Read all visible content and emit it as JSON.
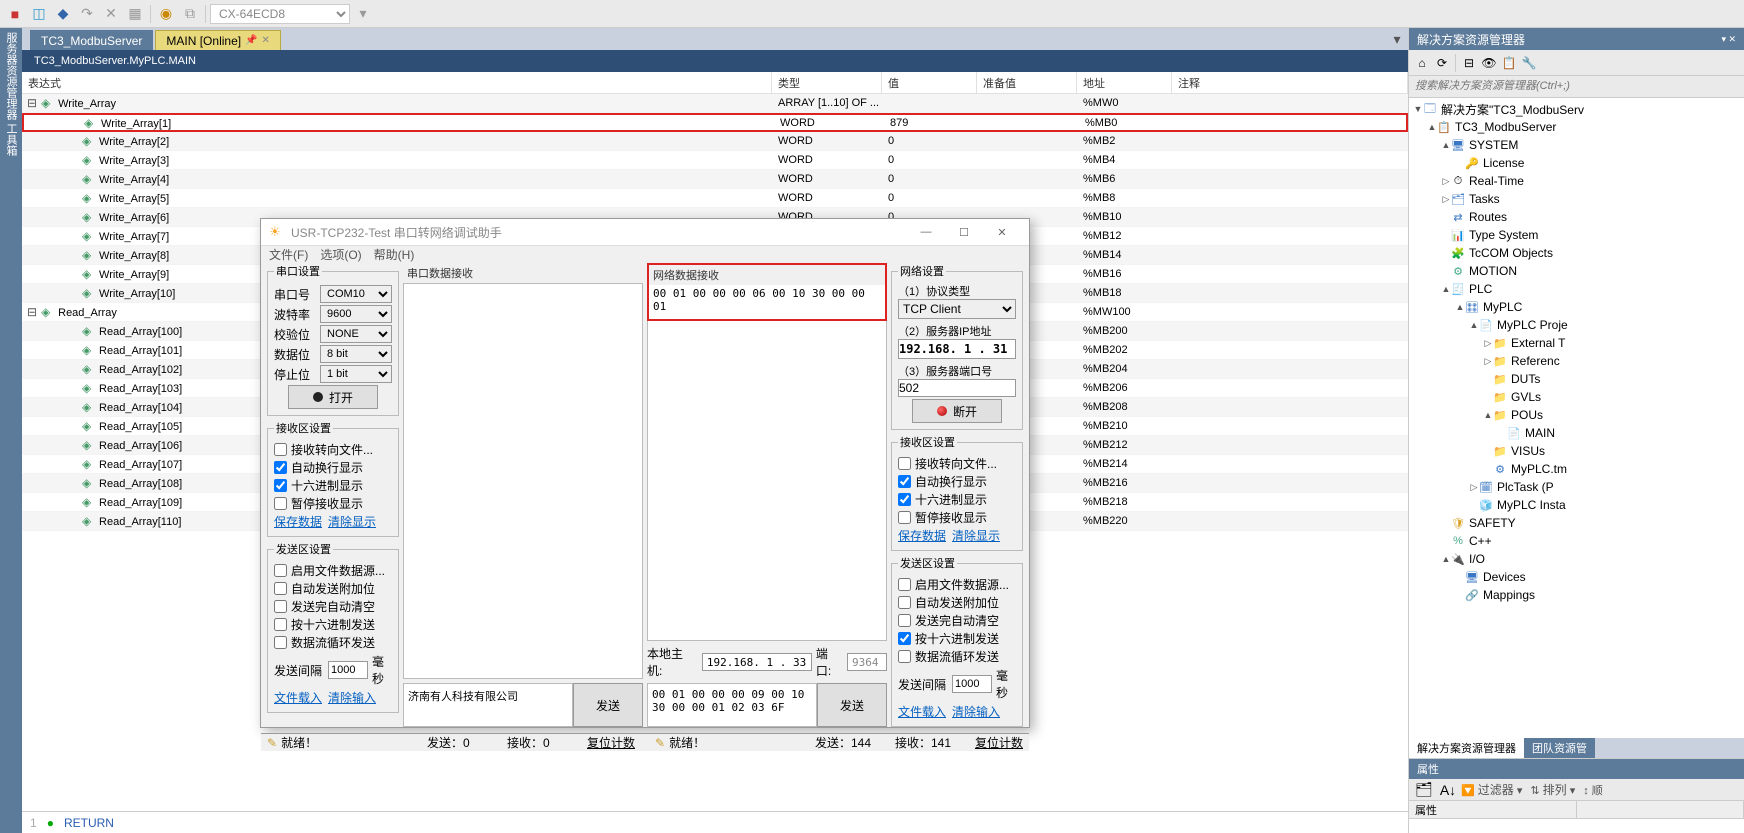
{
  "toolbar_combo": "CX-64ECD8",
  "left_sidebar_label": "服务器资源管理器 工具箱",
  "tabs": [
    {
      "label": "TC3_ModbuServer",
      "active": false
    },
    {
      "label": "MAIN [Online]",
      "active": true
    }
  ],
  "breadcrumb": "TC3_ModbuServer.MyPLC.MAIN",
  "columns": {
    "expr": "表达式",
    "type": "类型",
    "val": "值",
    "prep": "准备值",
    "addr": "地址",
    "comment": "注释"
  },
  "write_array_root": {
    "name": "Write_Array",
    "type": "ARRAY [1..10] OF ...",
    "addr": "%MW0"
  },
  "write_items": [
    {
      "name": "Write_Array[1]",
      "type": "WORD",
      "val": "879",
      "addr": "%MB0",
      "hl": true
    },
    {
      "name": "Write_Array[2]",
      "type": "WORD",
      "val": "0",
      "addr": "%MB2"
    },
    {
      "name": "Write_Array[3]",
      "type": "WORD",
      "val": "0",
      "addr": "%MB4"
    },
    {
      "name": "Write_Array[4]",
      "type": "WORD",
      "val": "0",
      "addr": "%MB6"
    },
    {
      "name": "Write_Array[5]",
      "type": "WORD",
      "val": "0",
      "addr": "%MB8"
    },
    {
      "name": "Write_Array[6]",
      "type": "WORD",
      "val": "0",
      "addr": "%MB10"
    },
    {
      "name": "Write_Array[7]",
      "type": "WORD",
      "val": "0",
      "addr": "%MB12"
    },
    {
      "name": "Write_Array[8]",
      "type": "WORD",
      "val": "0",
      "addr": "%MB14"
    },
    {
      "name": "Write_Array[9]",
      "type": "WORD",
      "val": "0",
      "addr": "%MB16"
    },
    {
      "name": "Write_Array[10]",
      "type": "WORD",
      "val": "0",
      "addr": "%MB18"
    }
  ],
  "read_array_root": {
    "name": "Read_Array",
    "addr": "%MW100"
  },
  "read_items": [
    {
      "name": "Read_Array[100]",
      "addr": "%MB200"
    },
    {
      "name": "Read_Array[101]",
      "addr": "%MB202"
    },
    {
      "name": "Read_Array[102]",
      "addr": "%MB204"
    },
    {
      "name": "Read_Array[103]",
      "addr": "%MB206"
    },
    {
      "name": "Read_Array[104]",
      "addr": "%MB208"
    },
    {
      "name": "Read_Array[105]",
      "addr": "%MB210"
    },
    {
      "name": "Read_Array[106]",
      "addr": "%MB212"
    },
    {
      "name": "Read_Array[107]",
      "addr": "%MB214"
    },
    {
      "name": "Read_Array[108]",
      "addr": "%MB216"
    },
    {
      "name": "Read_Array[109]",
      "addr": "%MB218"
    },
    {
      "name": "Read_Array[110]",
      "addr": "%MB220"
    }
  ],
  "code_line_num": "1",
  "code_line": "RETURN",
  "solution_explorer": {
    "title": "解决方案资源管理器",
    "search_placeholder": "搜索解决方案资源管理器(Ctrl+;)",
    "nodes": [
      {
        "d": 0,
        "exp": "▼",
        "icon": "🗔",
        "iconClass": "blue-icon",
        "label": "解决方案\"TC3_ModbuServ"
      },
      {
        "d": 1,
        "exp": "▲",
        "icon": "📋",
        "iconClass": "blue-icon",
        "label": "TC3_ModbuServer"
      },
      {
        "d": 2,
        "exp": "▲",
        "icon": "🖥",
        "iconClass": "blue-icon",
        "label": "SYSTEM"
      },
      {
        "d": 3,
        "exp": "",
        "icon": "🔑",
        "iconClass": "",
        "label": "License"
      },
      {
        "d": 2,
        "exp": "▷",
        "icon": "⏱",
        "iconClass": "",
        "label": "Real-Time"
      },
      {
        "d": 2,
        "exp": "▷",
        "icon": "🗂",
        "iconClass": "blue-icon",
        "label": "Tasks"
      },
      {
        "d": 2,
        "exp": "",
        "icon": "⇄",
        "iconClass": "blue-icon",
        "label": "Routes"
      },
      {
        "d": 2,
        "exp": "",
        "icon": "📊",
        "iconClass": "blue-icon",
        "label": "Type System"
      },
      {
        "d": 2,
        "exp": "",
        "icon": "🧩",
        "iconClass": "blue-icon",
        "label": "TcCOM Objects"
      },
      {
        "d": 2,
        "exp": "",
        "icon": "⚙",
        "iconClass": "green-icon",
        "label": "MOTION"
      },
      {
        "d": 2,
        "exp": "▲",
        "icon": "🧾",
        "iconClass": "blue-icon",
        "label": "PLC"
      },
      {
        "d": 3,
        "exp": "▲",
        "icon": "🎛",
        "iconClass": "blue-icon",
        "label": "MyPLC"
      },
      {
        "d": 4,
        "exp": "▲",
        "icon": "📄",
        "iconClass": "blue-icon",
        "label": "MyPLC Proje"
      },
      {
        "d": 5,
        "exp": "▷",
        "icon": "📁",
        "iconClass": "folder",
        "label": "External T"
      },
      {
        "d": 5,
        "exp": "▷",
        "icon": "📁",
        "iconClass": "folder",
        "label": "Referenc"
      },
      {
        "d": 5,
        "exp": "",
        "icon": "📁",
        "iconClass": "folder",
        "label": "DUTs"
      },
      {
        "d": 5,
        "exp": "",
        "icon": "📁",
        "iconClass": "folder",
        "label": "GVLs"
      },
      {
        "d": 5,
        "exp": "▲",
        "icon": "📁",
        "iconClass": "folder",
        "label": "POUs"
      },
      {
        "d": 6,
        "exp": "",
        "icon": "📄",
        "iconClass": "blue-icon",
        "label": "MAIN"
      },
      {
        "d": 5,
        "exp": "",
        "icon": "📁",
        "iconClass": "folder",
        "label": "VISUs"
      },
      {
        "d": 5,
        "exp": "",
        "icon": "⚙",
        "iconClass": "blue-icon",
        "label": "MyPLC.tm"
      },
      {
        "d": 4,
        "exp": "▷",
        "icon": "🗓",
        "iconClass": "blue-icon",
        "label": "PlcTask (P"
      },
      {
        "d": 4,
        "exp": "",
        "icon": "🧊",
        "iconClass": "blue-icon",
        "label": "MyPLC Insta"
      },
      {
        "d": 2,
        "exp": "",
        "icon": "🛡",
        "iconClass": "folder",
        "label": "SAFETY"
      },
      {
        "d": 2,
        "exp": "",
        "icon": "%",
        "iconClass": "green-icon",
        "label": "C++"
      },
      {
        "d": 2,
        "exp": "▲",
        "icon": "🔌",
        "iconClass": "blue-icon",
        "label": "I/O"
      },
      {
        "d": 3,
        "exp": "",
        "icon": "🖥",
        "iconClass": "blue-icon",
        "label": "Devices"
      },
      {
        "d": 3,
        "exp": "",
        "icon": "🔗",
        "iconClass": "blue-icon",
        "label": "Mappings"
      }
    ]
  },
  "prop_tabs": {
    "left": "解决方案资源管理器",
    "right": "团队资源管"
  },
  "prop_grid": {
    "title": "属性",
    "filter_label": "过滤器",
    "sort_label": "排列",
    "col1": "属性",
    "col2": ""
  },
  "dialog": {
    "title": "USR-TCP232-Test 串口转网络调试助手",
    "menus": [
      "文件(F)",
      "选项(O)",
      "帮助(H)"
    ],
    "serial": {
      "legend": "串口设置",
      "rows": {
        "port_label": "串口号",
        "port_val": "COM10",
        "baud_label": "波特率",
        "baud_val": "9600",
        "parity_label": "校验位",
        "parity_val": "NONE",
        "data_label": "数据位",
        "data_val": "8 bit",
        "stop_label": "停止位",
        "stop_val": "1 bit"
      },
      "open_btn": "打开"
    },
    "recv_settings": {
      "legend": "接收区设置",
      "opts": [
        {
          "label": "接收转向文件...",
          "checked": false
        },
        {
          "label": "自动换行显示",
          "checked": true
        },
        {
          "label": "十六进制显示",
          "checked": true
        },
        {
          "label": "暂停接收显示",
          "checked": false
        }
      ],
      "links": [
        "保存数据",
        "清除显示"
      ]
    },
    "send_settings": {
      "legend": "发送区设置",
      "opts": [
        {
          "label": "启用文件数据源...",
          "checked": false
        },
        {
          "label": "自动发送附加位",
          "checked": false
        },
        {
          "label": "发送完自动清空",
          "checked": false
        },
        {
          "label": "按十六进制发送",
          "checked": false
        },
        {
          "label": "数据流循环发送",
          "checked": false
        }
      ],
      "interval_label": "发送间隔",
      "interval_val": "1000",
      "interval_unit": "毫秒",
      "links": [
        "文件载入",
        "清除输入"
      ]
    },
    "net_settings": {
      "legend": "网络设置",
      "proto_label": "（1）协议类型",
      "proto_val": "TCP Client",
      "ip_label": "（2）服务器IP地址",
      "ip_val": "192.168. 1 . 31",
      "port_label": "（3）服务器端口号",
      "port_val": "502",
      "disconnect_btn": "断开"
    },
    "recv_settings_r": {
      "legend": "接收区设置",
      "opts": [
        {
          "label": "接收转向文件...",
          "checked": false
        },
        {
          "label": "自动换行显示",
          "checked": true
        },
        {
          "label": "十六进制显示",
          "checked": true
        },
        {
          "label": "暂停接收显示",
          "checked": false
        }
      ],
      "links": [
        "保存数据",
        "清除显示"
      ]
    },
    "send_settings_r": {
      "legend": "发送区设置",
      "opts": [
        {
          "label": "启用文件数据源...",
          "checked": false
        },
        {
          "label": "自动发送附加位",
          "checked": false
        },
        {
          "label": "发送完自动清空",
          "checked": false
        },
        {
          "label": "按十六进制发送",
          "checked": true
        },
        {
          "label": "数据流循环发送",
          "checked": false
        }
      ],
      "interval_label": "发送间隔",
      "interval_val": "1000",
      "interval_unit": "毫秒",
      "links": [
        "文件载入",
        "清除输入"
      ]
    },
    "serial_recv_title": "串口数据接收",
    "net_recv_title": "网络数据接收",
    "net_recv_data": "00 01 00 00 00 06 00 10 30 00 00 01",
    "host_label": "本地主机:",
    "host_val": "192.168. 1 . 33",
    "port_short_label": "端口:",
    "port_short_val": "9364",
    "send_left_text": "济南有人科技有限公司",
    "send_right_text": "00 01 00 00 00 09 00 10 30 00 00 01 02 03 6F",
    "send_btn": "发送",
    "status": {
      "ready": "就绪！",
      "s_send": "发送：0",
      "s_recv": "接收：0",
      "s_reset": "复位计数",
      "n_send": "发送：144",
      "n_recv": "接收：141",
      "n_reset": "复位计数"
    }
  }
}
